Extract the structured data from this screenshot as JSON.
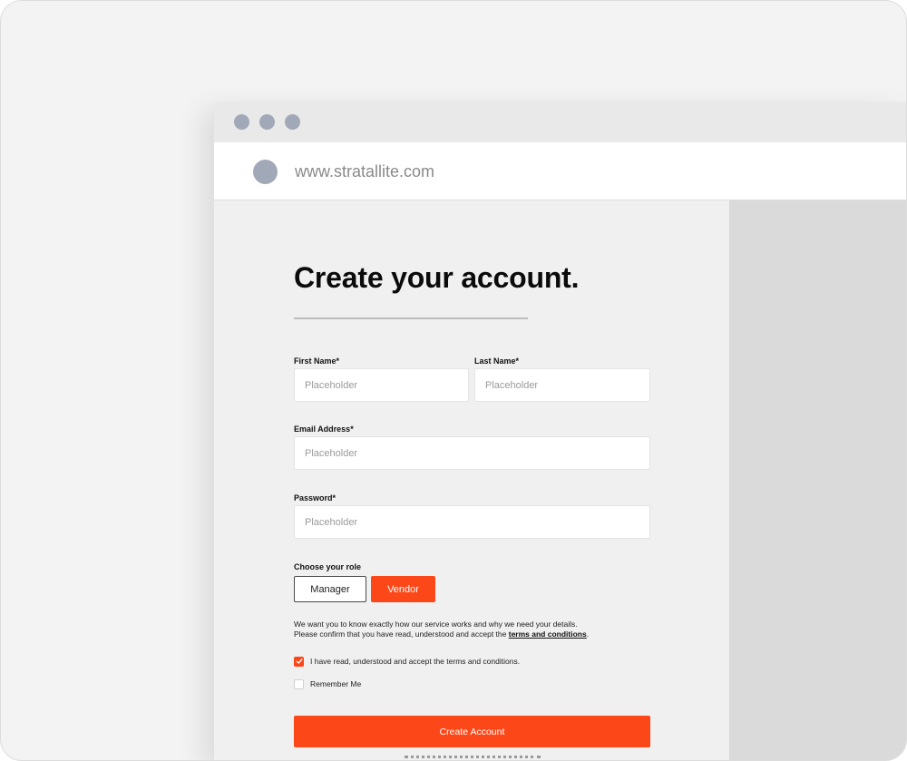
{
  "browser": {
    "url": "www.stratallite.com"
  },
  "form": {
    "title": "Create your account.",
    "first_name": {
      "label": "First Name*",
      "placeholder": "Placeholder"
    },
    "last_name": {
      "label": "Last Name*",
      "placeholder": "Placeholder"
    },
    "email": {
      "label": "Email Address*",
      "placeholder": "Placeholder"
    },
    "password": {
      "label": "Password*",
      "placeholder": "Placeholder"
    },
    "role": {
      "label": "Choose your role",
      "options": [
        "Manager",
        "Vendor"
      ],
      "selected": "Vendor"
    },
    "info_line1": "We want you to know exactly how our service works and why we need your details.",
    "info_line2": "Please confirm that you have read, understood and accept the",
    "terms_link": "terms and conditions",
    "info_end": ".",
    "terms_checkbox": {
      "label": "I have read, understood and accept the terms and conditions.",
      "checked": true
    },
    "remember_checkbox": {
      "label": "Remember Me",
      "checked": false
    },
    "submit_label": "Create Account"
  },
  "colors": {
    "accent": "#fc4719",
    "window_dot": "#a1a8b8",
    "side_panel": "#dadada"
  },
  "icons": [
    "check-icon",
    "favicon-circle",
    "window-dot"
  ]
}
